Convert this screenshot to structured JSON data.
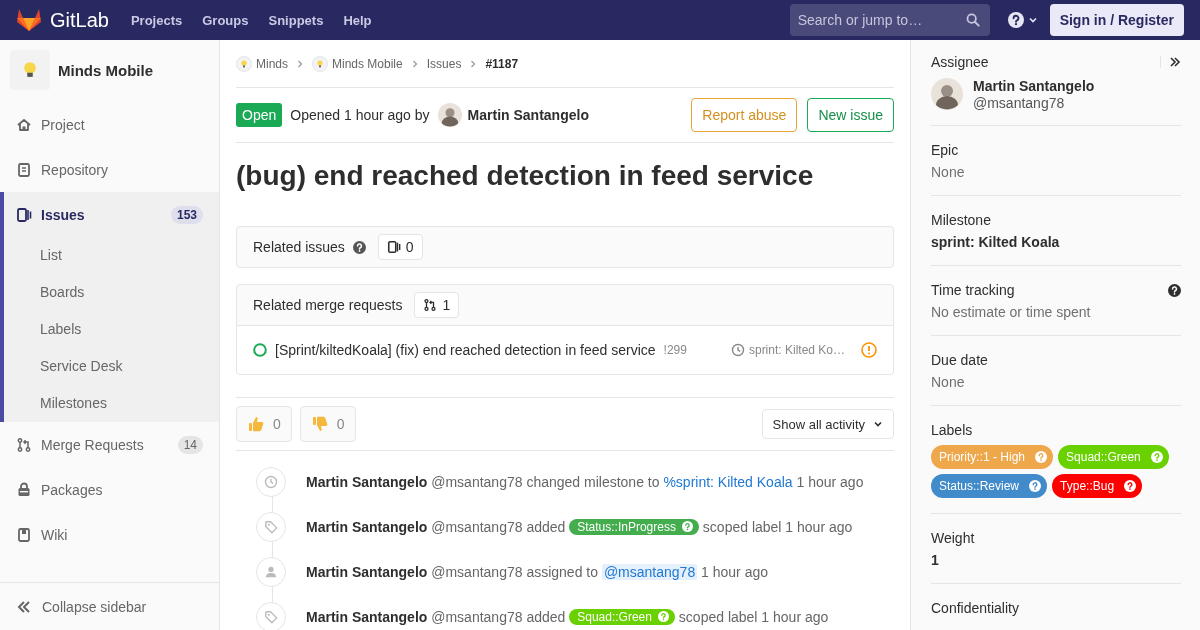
{
  "navbar": {
    "logo_text": "GitLab",
    "links": [
      "Projects",
      "Groups",
      "Snippets",
      "Help"
    ],
    "search": {
      "placeholder": "Search or jump to…"
    },
    "sign_in": "Sign in / Register"
  },
  "sidebar": {
    "project": "Minds Mobile",
    "items": [
      {
        "kind": "project",
        "label": "Project",
        "selected": false
      },
      {
        "kind": "repository",
        "label": "Repository",
        "selected": false
      },
      {
        "kind": "issues",
        "label": "Issues",
        "count": "153",
        "selected": true,
        "expanded": true,
        "children": [
          {
            "label": "List",
            "selected": false
          },
          {
            "label": "Boards",
            "selected": false
          },
          {
            "label": "Labels",
            "selected": false
          },
          {
            "label": "Service Desk",
            "selected": false
          },
          {
            "label": "Milestones",
            "selected": false
          }
        ]
      },
      {
        "kind": "merge_requests",
        "label": "Merge Requests",
        "count": "14",
        "selected": false
      },
      {
        "kind": "packages",
        "label": "Packages",
        "selected": false
      },
      {
        "kind": "wiki",
        "label": "Wiki",
        "selected": false
      }
    ],
    "collapse": "Collapse sidebar"
  },
  "breadcrumbs": [
    {
      "kind": "group",
      "label": "Minds"
    },
    {
      "kind": "group",
      "label": "Minds Mobile"
    },
    {
      "kind": "link",
      "label": "Issues"
    },
    {
      "kind": "current",
      "label": "#1187"
    }
  ],
  "issue": {
    "status": "Open",
    "opened": "Opened 1 hour ago by",
    "author": "Martin Santangelo",
    "report_button": "Report abuse",
    "new_button": "New issue",
    "title": "(bug) end reached detection in feed service"
  },
  "related_issues": {
    "title": "Related issues",
    "count": "0"
  },
  "related_mrs": {
    "title": "Related merge requests",
    "count": "1",
    "items": [
      {
        "title": "[Sprint/kiltedKoala] (fix) end reached detection in feed service",
        "ref": "!299",
        "milestone": "sprint: Kilted Ko…"
      }
    ]
  },
  "awards": [
    {
      "kind": "thumbsup",
      "count": "0"
    },
    {
      "kind": "thumbsdown",
      "count": "0"
    }
  ],
  "activity_filter": "Show all activity",
  "activity": [
    {
      "kind": "milestone",
      "author": "Martin Santangelo",
      "handle": "@msantang78",
      "action": "changed milestone to",
      "target": "%sprint: Kilted Koala",
      "time": "1 hour ago"
    },
    {
      "kind": "label",
      "author": "Martin Santangelo",
      "handle": "@msantang78",
      "action": "added",
      "target": "Status::InProgress",
      "color": "#44ad4e",
      "after": "scoped label",
      "time": "1 hour ago"
    },
    {
      "kind": "assign",
      "author": "Martin Santangelo",
      "handle": "@msantang78",
      "action": "assigned to",
      "target": "@msantang78",
      "time": "1 hour ago"
    },
    {
      "kind": "label",
      "author": "Martin Santangelo",
      "handle": "@msantang78",
      "action": "added",
      "target": "Squad::Green",
      "color": "#69d100",
      "after": "scoped label",
      "time": "1 hour ago"
    }
  ],
  "rightbar": [
    {
      "kind": "assignee",
      "title": "Assignee",
      "name": "Martin Santangelo",
      "handle": "@msantang78"
    },
    {
      "kind": "plain",
      "title": "Epic",
      "value": "None"
    },
    {
      "kind": "strong",
      "title": "Milestone",
      "value": "sprint: Kilted Koala"
    },
    {
      "kind": "plain",
      "title": "Time tracking",
      "help": true,
      "value": "No estimate or time spent"
    },
    {
      "kind": "plain",
      "title": "Due date",
      "value": "None"
    },
    {
      "kind": "labels",
      "title": "Labels",
      "labels": [
        {
          "text": "Priority::1 - High",
          "color": "#eea84b"
        },
        {
          "text": "Squad::Green",
          "color": "#69d100"
        },
        {
          "text": "Status::Review",
          "color": "#428bca"
        },
        {
          "text": "Type::Bug",
          "color": "#ff0000"
        }
      ]
    },
    {
      "kind": "strong",
      "title": "Weight",
      "value": "1"
    },
    {
      "kind": "title",
      "title": "Confidentiality"
    }
  ]
}
